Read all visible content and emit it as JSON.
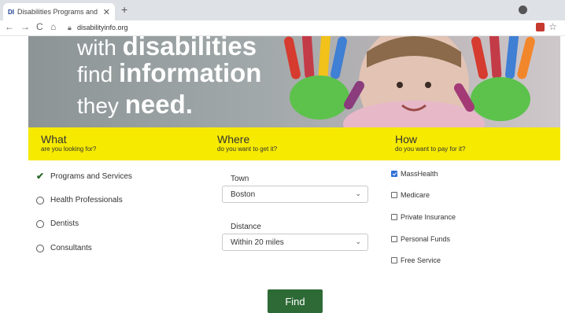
{
  "browser": {
    "tab_title": "Disabilities Programs and Services",
    "tab_favicon": "DI",
    "url": "disabilityinfo.org"
  },
  "hero": {
    "line1_pre": "with ",
    "line1_bold": "disabilities",
    "line2_pre": "find ",
    "line2_bold": "information",
    "line3_pre": "they ",
    "line3_bold": "need",
    "line3_post": "."
  },
  "band": {
    "what": {
      "title": "What",
      "subtitle": "are you looking for?"
    },
    "where": {
      "title": "Where",
      "subtitle": "do you want to get it?"
    },
    "how": {
      "title": "How",
      "subtitle": "do you want to pay for it?"
    }
  },
  "what_options": [
    {
      "label": "Programs and Services",
      "selected": true
    },
    {
      "label": "Health Professionals",
      "selected": false
    },
    {
      "label": "Dentists",
      "selected": false
    },
    {
      "label": "Consultants",
      "selected": false
    }
  ],
  "where": {
    "town_label": "Town",
    "town_value": "Boston",
    "distance_label": "Distance",
    "distance_value": "Within 20 miles"
  },
  "how_options": [
    {
      "label": "MassHealth",
      "checked": true
    },
    {
      "label": "Medicare",
      "checked": false
    },
    {
      "label": "Private Insurance",
      "checked": false
    },
    {
      "label": "Personal Funds",
      "checked": false
    },
    {
      "label": "Free Service",
      "checked": false
    }
  ],
  "find_label": "Find",
  "colors": {
    "band": "#f6ea00",
    "find_button": "#2e6a36",
    "check": "#2d6a2d"
  }
}
